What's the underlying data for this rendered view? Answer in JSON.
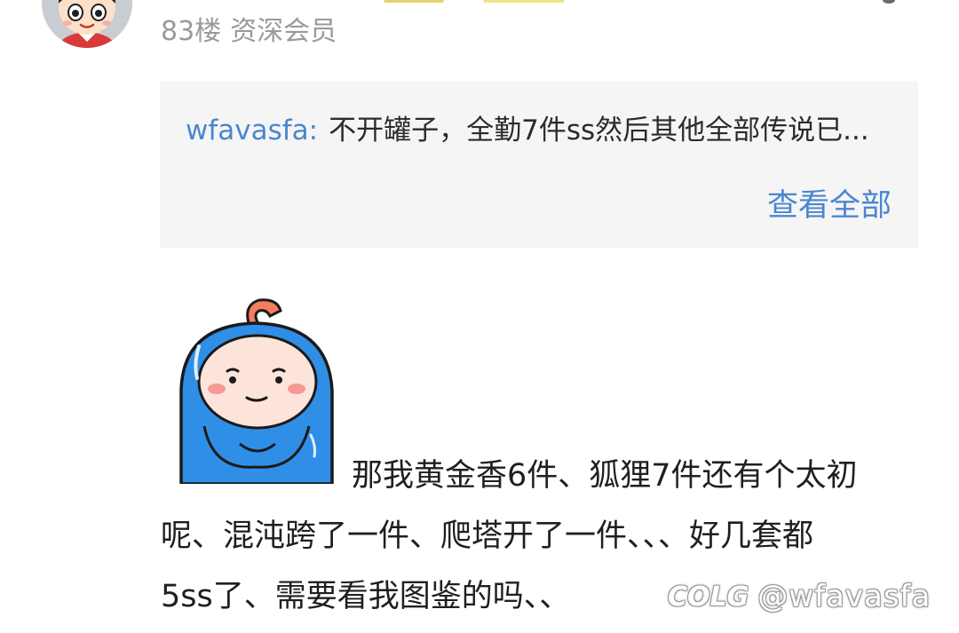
{
  "post": {
    "floor": "83楼",
    "member_level": "资深会员"
  },
  "reply_preview": {
    "username": "wfavasfa",
    "colon": ":",
    "text": "不开罐子，全勤7件ss然后其他全部传说已..."
  },
  "view_all_label": "查看全部",
  "content": {
    "line1": "那我黄金香6件、狐狸7件还有个太初",
    "line2": "呢、混沌跨了一件、爬塔开了一件、、、好几套都",
    "line3": "5ss了、需要看我图鉴的吗、、"
  },
  "watermark": {
    "logo": "COLG",
    "handle": "@wfavasfa"
  },
  "colors": {
    "link": "#4a86cf",
    "muted_text": "#9a9a9a",
    "reply_background": "#f5f5f5",
    "badge_gold": "#e7d26c",
    "badge_yellow": "#efe38a",
    "sticker_blue": "#2f8fe6",
    "sticker_orange": "#f47d5e"
  },
  "icons": {
    "avatar": "cartoon-boy-avatar",
    "sticker": "blue-hooded-character-sticker",
    "more": "more-dots-icon"
  }
}
